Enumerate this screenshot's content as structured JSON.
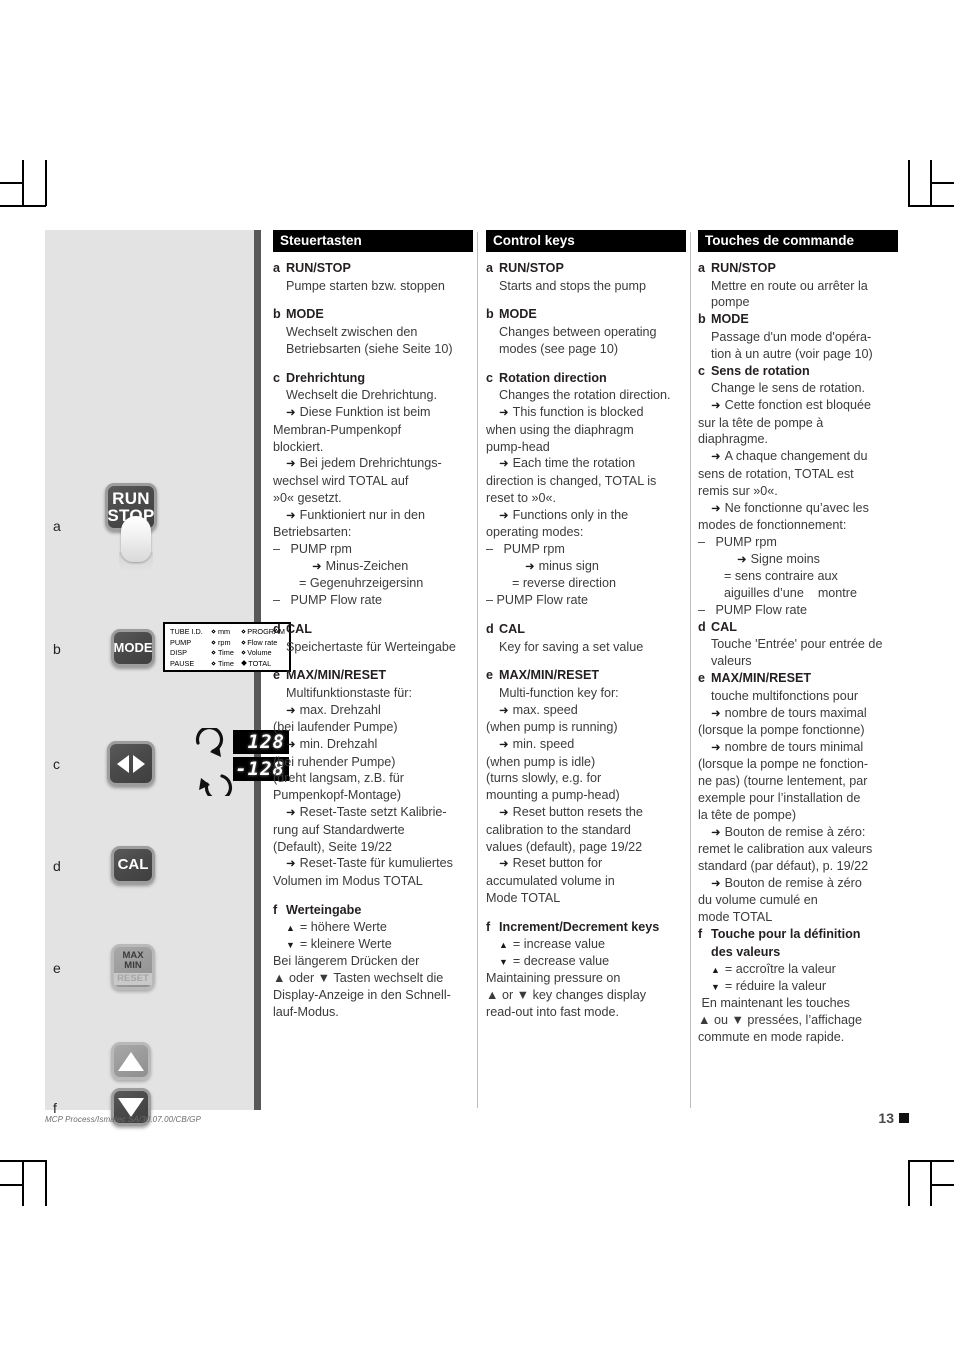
{
  "footer": {
    "reference": "MCP Process/Ismatec SA/30.07.00/CB/GP",
    "page_number": "13"
  },
  "illustration": {
    "labels": {
      "a": "a",
      "b": "b",
      "c": "c",
      "d": "d",
      "e": "e",
      "f": "f"
    },
    "buttons": {
      "run": "RUN",
      "stop": "STOP",
      "mode": "MODE",
      "cal": "CAL",
      "max": "MAX",
      "min": "MIN",
      "reset": "RESET"
    },
    "mode_panel": {
      "rows": [
        {
          "c1": "TUBE I.D.",
          "c2": "mm",
          "c3": "PROGRAM"
        },
        {
          "c1": "PUMP",
          "c2": "rpm",
          "c3": "Flow rate"
        },
        {
          "c1": "DISP",
          "c2": "Time",
          "c3": "Volume"
        },
        {
          "c1": "PAUSE",
          "c2": "Time",
          "c3": "TOTAL"
        }
      ]
    },
    "display": {
      "clockwise_value": "128",
      "counterclockwise_value": "-128"
    }
  },
  "columns": {
    "de": {
      "heading": "Steuertasten",
      "entries": [
        {
          "letter": "a",
          "title": "RUN/STOP",
          "lines": [
            {
              "text": "Pumpe starten bzw. stoppen",
              "style": "ind"
            }
          ]
        },
        {
          "letter": "b",
          "title": "MODE",
          "lines": [
            {
              "text": "Wechselt zwischen den",
              "style": "ind"
            },
            {
              "text": "Betriebsarten (siehe Seite 10)",
              "style": "ind"
            }
          ]
        },
        {
          "letter": "c",
          "title": "Drehrichtung",
          "lines": [
            {
              "text": "Wechselt die Drehrichtung.",
              "style": "ind"
            },
            {
              "text": "Diese Funktion ist beim",
              "style": "ind arrow"
            },
            {
              "text": "Membran-Pumpenkopf",
              "style": ""
            },
            {
              "text": "blockiert.",
              "style": ""
            },
            {
              "text": "Bei jedem Drehrichtungs-",
              "style": "ind arrow"
            },
            {
              "text": "wechsel wird TOTAL auf",
              "style": ""
            },
            {
              "text": "»0« gesetzt.",
              "style": ""
            },
            {
              "text": "Funktioniert nur in den",
              "style": "ind arrow"
            },
            {
              "text": "Betriebsarten:",
              "style": ""
            },
            {
              "text": "–   PUMP rpm",
              "style": ""
            },
            {
              "text": "Minus-Zeichen",
              "style": "ind3 arrow"
            },
            {
              "text": "= Gegenuhrzeigersinn",
              "style": "ind2"
            },
            {
              "text": "–   PUMP Flow rate",
              "style": ""
            }
          ]
        },
        {
          "letter": "d",
          "title": "CAL",
          "lines": [
            {
              "text": "Speichertaste für Werteingabe",
              "style": "ind"
            }
          ]
        },
        {
          "letter": "e",
          "title": "MAX/MIN/RESET",
          "lines": [
            {
              "text": "Multifunktionstaste für:",
              "style": "ind"
            },
            {
              "text": "max. Drehzahl",
              "style": "ind arrow"
            },
            {
              "text": "(bei laufender Pumpe)",
              "style": ""
            },
            {
              "text": "min. Drehzahl",
              "style": "ind arrow"
            },
            {
              "text": "(bei ruhender Pumpe)",
              "style": ""
            },
            {
              "text": "(dreht langsam, z.B. für",
              "style": ""
            },
            {
              "text": "Pumpenkopf-Montage)",
              "style": ""
            },
            {
              "text": "Reset-Taste setzt Kalibrie-",
              "style": "ind arrow"
            },
            {
              "text": "rung auf Standardwerte",
              "style": ""
            },
            {
              "text": "(Default), Seite 19/22",
              "style": ""
            },
            {
              "text": "Reset-Taste für kumuliertes",
              "style": "ind arrow"
            },
            {
              "text": "Volumen im Modus TOTAL",
              "style": ""
            }
          ]
        },
        {
          "letter": "f",
          "title": "Werteingabe",
          "lines": [
            {
              "text": "= höhere Werte",
              "style": "ind up-tri"
            },
            {
              "text": "= kleinere Werte",
              "style": "ind dn-tri"
            },
            {
              "text": "Bei längerem Drücken der",
              "style": ""
            },
            {
              "text": "▲ oder ▼ Tasten wechselt die",
              "style": ""
            },
            {
              "text": "Display-Anzeige in den Schnell-",
              "style": ""
            },
            {
              "text": "lauf-Modus.",
              "style": ""
            }
          ]
        }
      ]
    },
    "en": {
      "heading": "Control keys",
      "entries": [
        {
          "letter": "a",
          "title": "RUN/STOP",
          "lines": [
            {
              "text": "Starts and stops the pump",
              "style": "ind"
            }
          ]
        },
        {
          "letter": "b",
          "title": "MODE",
          "lines": [
            {
              "text": "Changes between operating",
              "style": "ind"
            },
            {
              "text": "modes (see page 10)",
              "style": "ind"
            }
          ]
        },
        {
          "letter": "c",
          "title": "Rotation direction",
          "lines": [
            {
              "text": "Changes the rotation direction.",
              "style": "ind"
            },
            {
              "text": "This function is blocked",
              "style": "ind arrow"
            },
            {
              "text": "when using the diaphragm",
              "style": ""
            },
            {
              "text": "pump-head",
              "style": ""
            },
            {
              "text": "Each time the rotation",
              "style": "ind arrow"
            },
            {
              "text": "direction is changed, TOTAL is",
              "style": ""
            },
            {
              "text": "reset to »0«.",
              "style": ""
            },
            {
              "text": "Functions only in the",
              "style": "ind arrow"
            },
            {
              "text": "operating modes:",
              "style": ""
            },
            {
              "text": "–   PUMP rpm",
              "style": ""
            },
            {
              "text": "minus sign",
              "style": "ind3 arrow"
            },
            {
              "text": "= reverse direction",
              "style": "ind2"
            },
            {
              "text": "– PUMP Flow rate",
              "style": ""
            }
          ]
        },
        {
          "letter": "d",
          "title": "CAL",
          "lines": [
            {
              "text": "Key for saving a set value",
              "style": "ind"
            }
          ]
        },
        {
          "letter": "e",
          "title": "MAX/MIN/RESET",
          "lines": [
            {
              "text": "Multi-function key for:",
              "style": "ind"
            },
            {
              "text": "max. speed",
              "style": "ind arrow"
            },
            {
              "text": "(when pump is running)",
              "style": ""
            },
            {
              "text": "min. speed",
              "style": "ind arrow"
            },
            {
              "text": "(when pump is idle)",
              "style": ""
            },
            {
              "text": "(turns slowly, e.g. for",
              "style": ""
            },
            {
              "text": "mounting a pump-head)",
              "style": ""
            },
            {
              "text": "Reset button resets the",
              "style": "ind arrow"
            },
            {
              "text": "calibration to the standard",
              "style": ""
            },
            {
              "text": "values (default), page 19/22",
              "style": ""
            },
            {
              "text": "Reset button for",
              "style": "ind arrow"
            },
            {
              "text": "accumulated volume in",
              "style": ""
            },
            {
              "text": "Mode TOTAL",
              "style": ""
            }
          ]
        },
        {
          "letter": "f",
          "title": "Increment/Decrement keys",
          "lines": [
            {
              "text": "= increase value",
              "style": "ind up-tri"
            },
            {
              "text": "= decrease value",
              "style": "ind dn-tri"
            },
            {
              "text": "Maintaining pressure on",
              "style": ""
            },
            {
              "text": "▲ or ▼ key changes display",
              "style": ""
            },
            {
              "text": "read-out into fast mode.",
              "style": ""
            }
          ]
        }
      ]
    },
    "fr": {
      "heading": "Touches de commande",
      "entries": [
        {
          "letter": "a",
          "title": "RUN/STOP",
          "lines": [
            {
              "text": "Mettre en route ou arrêter la",
              "style": "ind"
            },
            {
              "text": "pompe",
              "style": "ind"
            }
          ]
        },
        {
          "letter": "b",
          "title": "MODE",
          "lines": [
            {
              "text": "Passage d'un mode d'opéra-",
              "style": "ind"
            },
            {
              "text": "tion à un autre (voir page 10)",
              "style": "ind"
            }
          ]
        },
        {
          "letter": "c",
          "title": "Sens de rotation",
          "lines": [
            {
              "text": "Change le sens de rotation.",
              "style": "ind"
            },
            {
              "text": "Cette fonction est bloquée",
              "style": "ind arrow"
            },
            {
              "text": "sur la tête de pompe à",
              "style": ""
            },
            {
              "text": "diaphragme.",
              "style": ""
            },
            {
              "text": "A chaque changement du",
              "style": "ind arrow"
            },
            {
              "text": "sens de rotation, TOTAL est",
              "style": ""
            },
            {
              "text": "remis sur »0«.",
              "style": ""
            },
            {
              "text": "Ne fonctionne qu’avec les",
              "style": "ind arrow"
            },
            {
              "text": "modes de fonctionnement:",
              "style": ""
            },
            {
              "text": "–   PUMP rpm",
              "style": ""
            },
            {
              "text": "Signe moins",
              "style": "ind3 arrow"
            },
            {
              "text": "= sens contraire aux",
              "style": "ind2"
            },
            {
              "text": "aiguilles d’une    montre",
              "style": "ind2"
            },
            {
              "text": "–   PUMP Flow rate",
              "style": ""
            }
          ]
        },
        {
          "letter": "d",
          "title": "CAL",
          "lines": [
            {
              "text": "Touche 'Entrée' pour entrée de",
              "style": "ind"
            },
            {
              "text": "valeurs",
              "style": "ind"
            }
          ]
        },
        {
          "letter": "e",
          "title": "MAX/MIN/RESET",
          "lines": [
            {
              "text": "touche multifonctions pour",
              "style": "ind"
            },
            {
              "text": "nombre de tours maximal",
              "style": "ind arrow"
            },
            {
              "text": "(lorsque la pompe fonctionne)",
              "style": ""
            },
            {
              "text": "nombre de tours minimal",
              "style": "ind arrow"
            },
            {
              "text": "(lorsque la pompe ne fonction-",
              "style": ""
            },
            {
              "text": "ne pas) (tourne lentement, par",
              "style": ""
            },
            {
              "text": "exemple pour l’installation de",
              "style": ""
            },
            {
              "text": "la tête de pompe)",
              "style": ""
            },
            {
              "text": "Bouton de remise à zéro:",
              "style": "ind arrow"
            },
            {
              "text": "remet le calibration aux valeurs",
              "style": ""
            },
            {
              "text": "standard (par défaut), p. 19/22",
              "style": ""
            },
            {
              "text": "Bouton de remise à zéro",
              "style": "ind arrow"
            },
            {
              "text": "du volume cumulé en",
              "style": ""
            },
            {
              "text": "mode TOTAL",
              "style": ""
            }
          ]
        },
        {
          "letter": "f",
          "title": "Touche pour la définition",
          "title2": "des valeurs",
          "lines": [
            {
              "text": "= accroître la valeur",
              "style": "ind up-tri"
            },
            {
              "text": "= réduire la valeur",
              "style": "ind dn-tri"
            },
            {
              "text": " En maintenant les touches",
              "style": ""
            },
            {
              "text": "▲ ou ▼ pressées, l’affichage",
              "style": ""
            },
            {
              "text": "commute en mode rapide.",
              "style": ""
            }
          ]
        }
      ]
    }
  }
}
